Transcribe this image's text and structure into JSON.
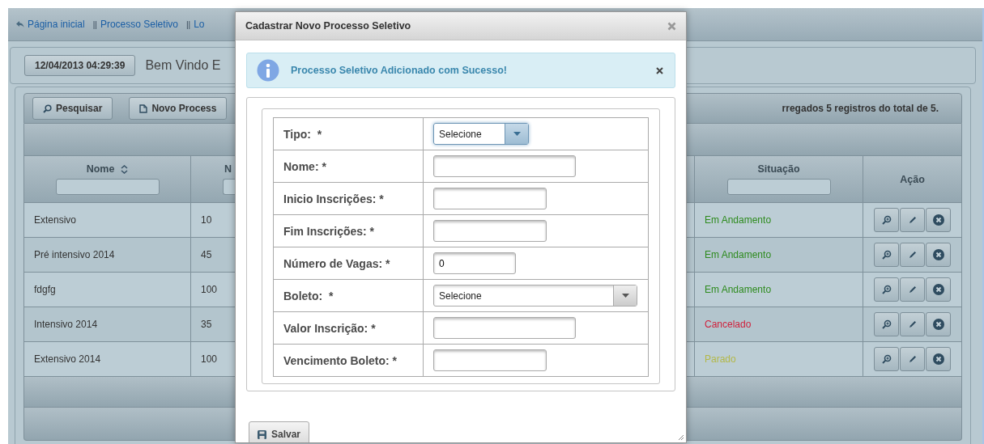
{
  "breadcrumb": [
    {
      "label": "Página inicial"
    },
    {
      "label": "Processo Seletivo",
      "separator": "||"
    },
    {
      "label": "Lo",
      "separator": "||"
    }
  ],
  "header": {
    "datetime": "12/04/2013 04:29:39",
    "welcome": "Bem Vindo E"
  },
  "toolbar": {
    "buttons": [
      {
        "label": "Pesquisar",
        "kind": "search"
      },
      {
        "label": "Novo Process",
        "kind": "new"
      }
    ],
    "status": "rregados 5 registros do total de 5."
  },
  "table": {
    "columns": [
      {
        "label": "Nome",
        "sortable": true,
        "filter": true
      },
      {
        "label": "N",
        "filter": true
      },
      {
        "label": "Situação",
        "filter": true
      },
      {
        "label": "Ação"
      }
    ],
    "rows": [
      {
        "nome": "Extensivo",
        "column_2": "10",
        "situacao": "Em Andamento",
        "color": "#2e8b1e"
      },
      {
        "nome": "Pré intensivo 2014",
        "column_2": "45",
        "situacao": "Em Andamento",
        "color": "#2e8b1e"
      },
      {
        "nome": "fdgfg",
        "column_2": "100",
        "situacao": "Em Andamento",
        "color": "#2e8b1e"
      },
      {
        "nome": "Intensivo 2014",
        "column_2": "35",
        "situacao": "Cancelado",
        "color": "#d0213c"
      },
      {
        "nome": "Extensivo 2014",
        "column_2": "100",
        "situacao": "Parado",
        "color": "#b3b848"
      }
    ]
  },
  "dialog": {
    "title": "Cadastrar Novo Processo Seletivo",
    "alert": {
      "message": "Processo Seletivo Adicionado com Sucesso!"
    },
    "fields": [
      {
        "label": "Tipo:  *",
        "kind": "select",
        "value": "Selecione"
      },
      {
        "label": "Nome: *",
        "kind": "text"
      },
      {
        "label": "Inicio Inscrições: *",
        "kind": "text"
      },
      {
        "label": "Fim Inscrições: *",
        "kind": "text"
      },
      {
        "label": "Número de Vagas: *",
        "kind": "text",
        "value": "0"
      },
      {
        "label": "Boleto:  *",
        "kind": "select",
        "value": "Selecione"
      },
      {
        "label": "Valor Inscrição: *",
        "kind": "text"
      },
      {
        "label": "Vencimento Boleto: *",
        "kind": "text"
      }
    ],
    "submit": "Salvar"
  }
}
